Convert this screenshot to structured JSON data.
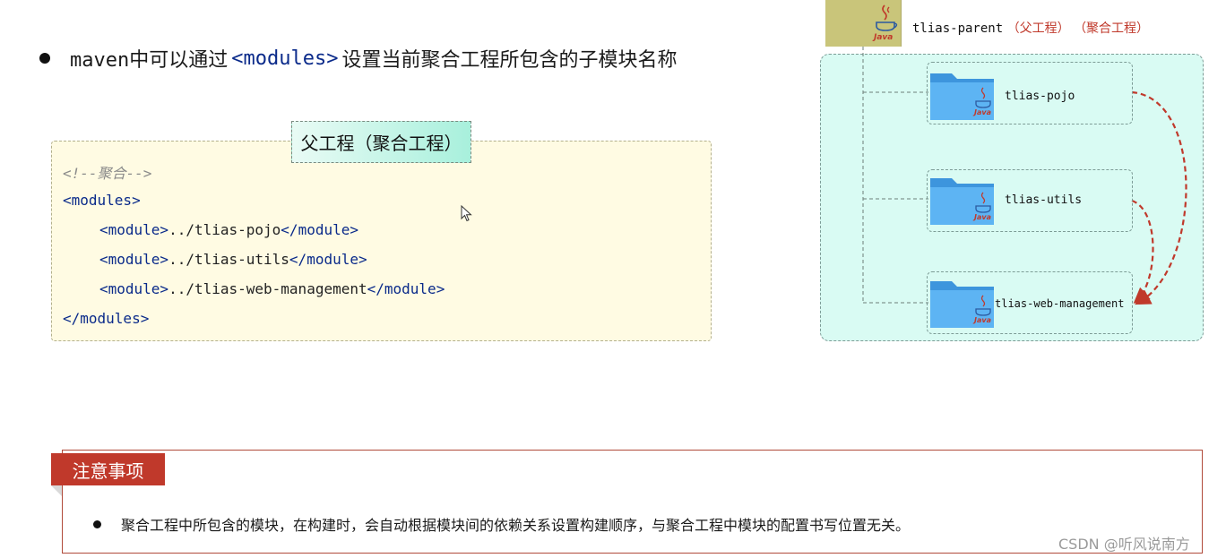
{
  "headline": {
    "prefix": "maven中可以通过",
    "code": "<modules>",
    "suffix": "设置当前聚合工程所包含的子模块名称"
  },
  "code_card": {
    "tag": "父工程（聚合工程）",
    "comment": "<!--聚合-->",
    "open_tag": "<modules>",
    "modules": [
      {
        "open": "<module>",
        "path": "../tlias-pojo",
        "close": "</module>"
      },
      {
        "open": "<module>",
        "path": "../tlias-utils",
        "close": "</module>"
      },
      {
        "open": "<module>",
        "path": "../tlias-web-management",
        "close": "</module>"
      }
    ],
    "close_tag": "</modules>"
  },
  "diagram": {
    "parent": {
      "name": "tlias-parent",
      "tag1": "（父工程）",
      "tag2": "（聚合工程）"
    },
    "children": [
      "tlias-pojo",
      "tlias-utils",
      "tlias-web-management"
    ],
    "java_label": "Java",
    "colors": {
      "panel": "#d9fbf3",
      "folder": "#4aa7ee",
      "arrow": "#c0392b",
      "parent_box": "#c9c57a"
    }
  },
  "note": {
    "title": "注意事项",
    "text": "聚合工程中所包含的模块，在构建时，会自动根据模块间的依赖关系设置构建顺序，与聚合工程中模块的配置书写位置无关。"
  },
  "watermark": "CSDN @听风说南方"
}
